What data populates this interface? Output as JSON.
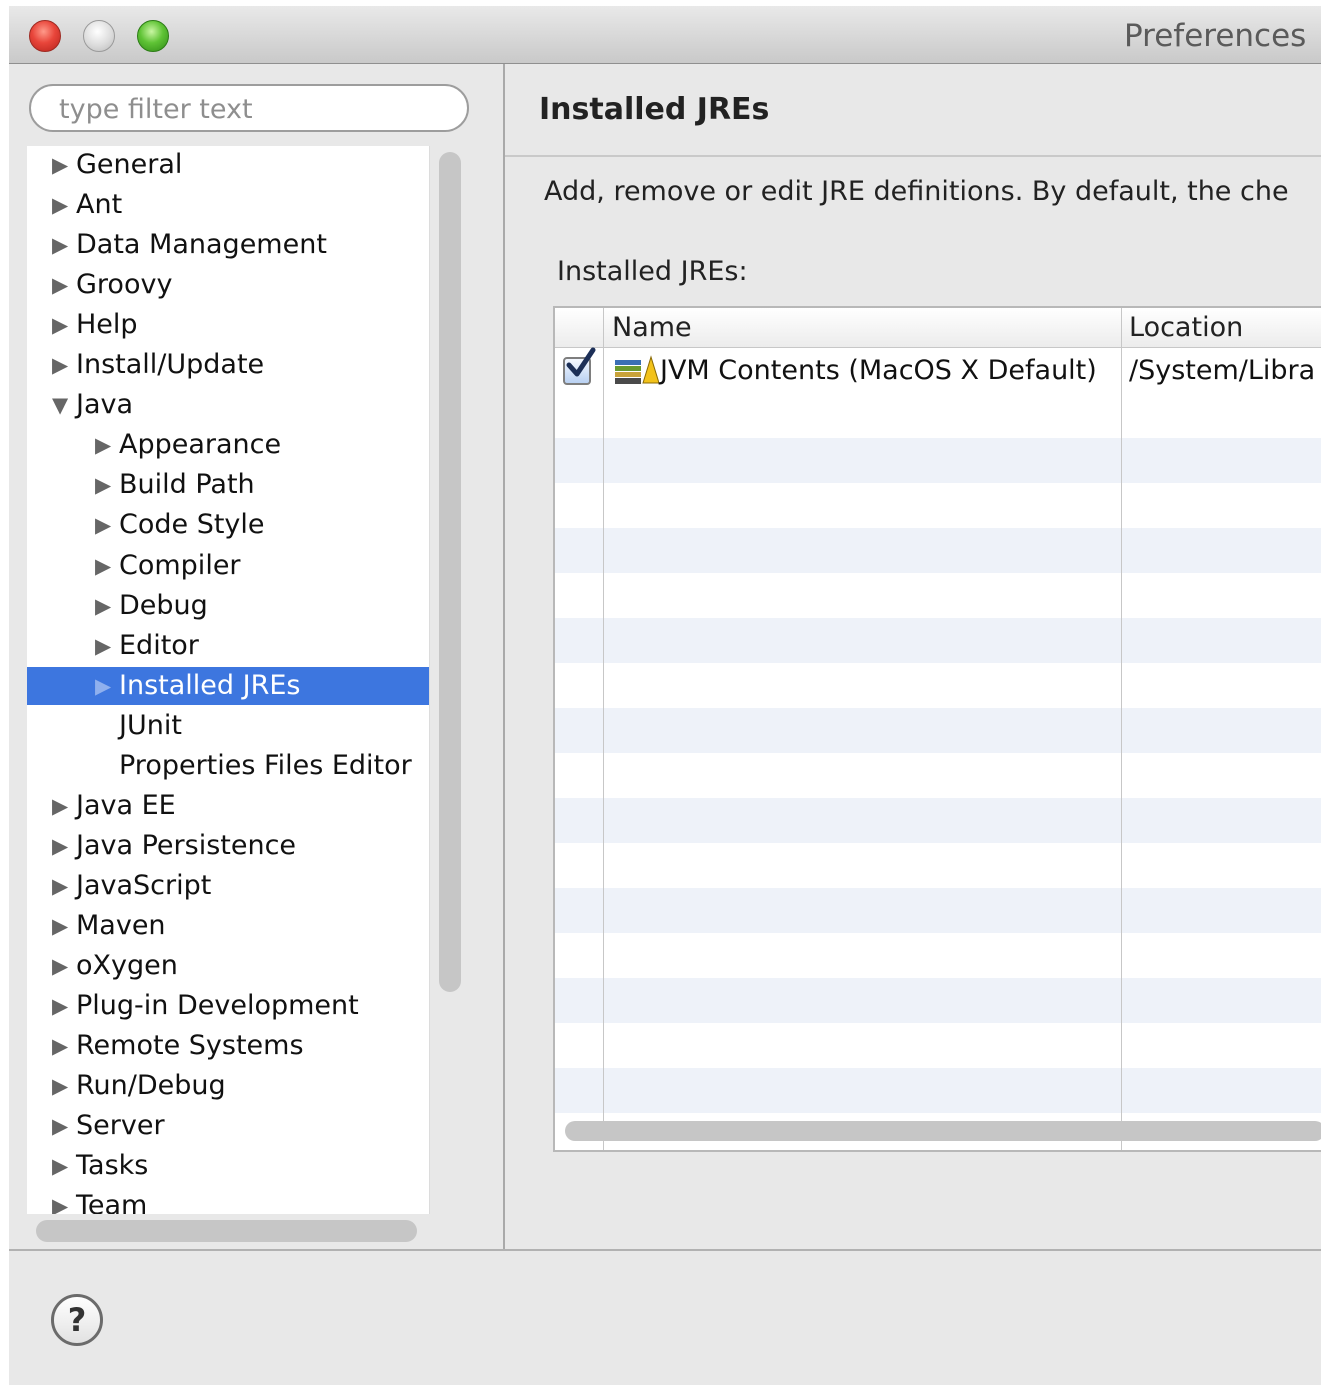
{
  "window": {
    "title": "Preferences"
  },
  "filter": {
    "placeholder": "type filter text"
  },
  "tree": {
    "items": [
      {
        "label": "General",
        "level": 0,
        "arrow": "▶"
      },
      {
        "label": "Ant",
        "level": 0,
        "arrow": "▶"
      },
      {
        "label": "Data Management",
        "level": 0,
        "arrow": "▶"
      },
      {
        "label": "Groovy",
        "level": 0,
        "arrow": "▶"
      },
      {
        "label": "Help",
        "level": 0,
        "arrow": "▶"
      },
      {
        "label": "Install/Update",
        "level": 0,
        "arrow": "▶"
      },
      {
        "label": "Java",
        "level": 0,
        "arrow": "▼"
      },
      {
        "label": "Appearance",
        "level": 1,
        "arrow": "▶"
      },
      {
        "label": "Build Path",
        "level": 1,
        "arrow": "▶"
      },
      {
        "label": "Code Style",
        "level": 1,
        "arrow": "▶"
      },
      {
        "label": "Compiler",
        "level": 1,
        "arrow": "▶"
      },
      {
        "label": "Debug",
        "level": 1,
        "arrow": "▶"
      },
      {
        "label": "Editor",
        "level": 1,
        "arrow": "▶"
      },
      {
        "label": "Installed JREs",
        "level": 1,
        "arrow": "▶",
        "selected": true
      },
      {
        "label": "JUnit",
        "level": 1,
        "arrow": ""
      },
      {
        "label": "Properties Files Editor",
        "level": 1,
        "arrow": ""
      },
      {
        "label": "Java EE",
        "level": 0,
        "arrow": "▶"
      },
      {
        "label": "Java Persistence",
        "level": 0,
        "arrow": "▶"
      },
      {
        "label": "JavaScript",
        "level": 0,
        "arrow": "▶"
      },
      {
        "label": "Maven",
        "level": 0,
        "arrow": "▶"
      },
      {
        "label": "oXygen",
        "level": 0,
        "arrow": "▶"
      },
      {
        "label": "Plug-in Development",
        "level": 0,
        "arrow": "▶"
      },
      {
        "label": "Remote Systems",
        "level": 0,
        "arrow": "▶"
      },
      {
        "label": "Run/Debug",
        "level": 0,
        "arrow": "▶"
      },
      {
        "label": "Server",
        "level": 0,
        "arrow": "▶"
      },
      {
        "label": "Tasks",
        "level": 0,
        "arrow": "▶"
      },
      {
        "label": "Team",
        "level": 0,
        "arrow": "▶"
      }
    ]
  },
  "page": {
    "title": "Installed JREs",
    "description": "Add, remove or edit JRE definitions. By default, the che",
    "table_label": "Installed JREs:"
  },
  "table": {
    "columns": [
      "Name",
      "Location"
    ],
    "rows": [
      {
        "checked": true,
        "name": "JVM Contents (MacOS X Default)",
        "location": "/System/Libra",
        "icon": "jre-library-icon"
      }
    ]
  },
  "help": {
    "glyph": "?"
  },
  "colors": {
    "selection": "#3d76df",
    "alt_row": "#eef2f9"
  }
}
